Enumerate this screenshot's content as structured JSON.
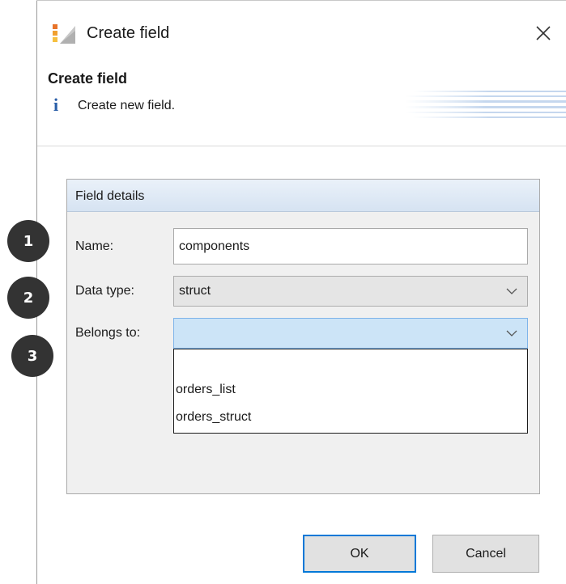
{
  "window": {
    "title": "Create field",
    "close_icon": "close-icon",
    "app_icon": "app-icon"
  },
  "header": {
    "title": "Create field",
    "info_icon": "info-icon",
    "info_text": "Create new field."
  },
  "group": {
    "title": "Field details"
  },
  "form": {
    "name_label": "Name:",
    "name_value": "components",
    "datatype_label": "Data type:",
    "datatype_value": "struct",
    "belongs_label": "Belongs to:",
    "belongs_value": "",
    "belongs_options": [
      "",
      "orders_list",
      "orders_struct"
    ]
  },
  "badges": [
    "1",
    "2",
    "3"
  ],
  "buttons": {
    "ok_label": "OK",
    "cancel_label": "Cancel"
  },
  "colors": {
    "accent": "#0078d7",
    "selected_combo": "#cce4f7",
    "group_header": "#d6e3f2",
    "badge": "#333333",
    "info_icon": "#2a5fa8"
  }
}
